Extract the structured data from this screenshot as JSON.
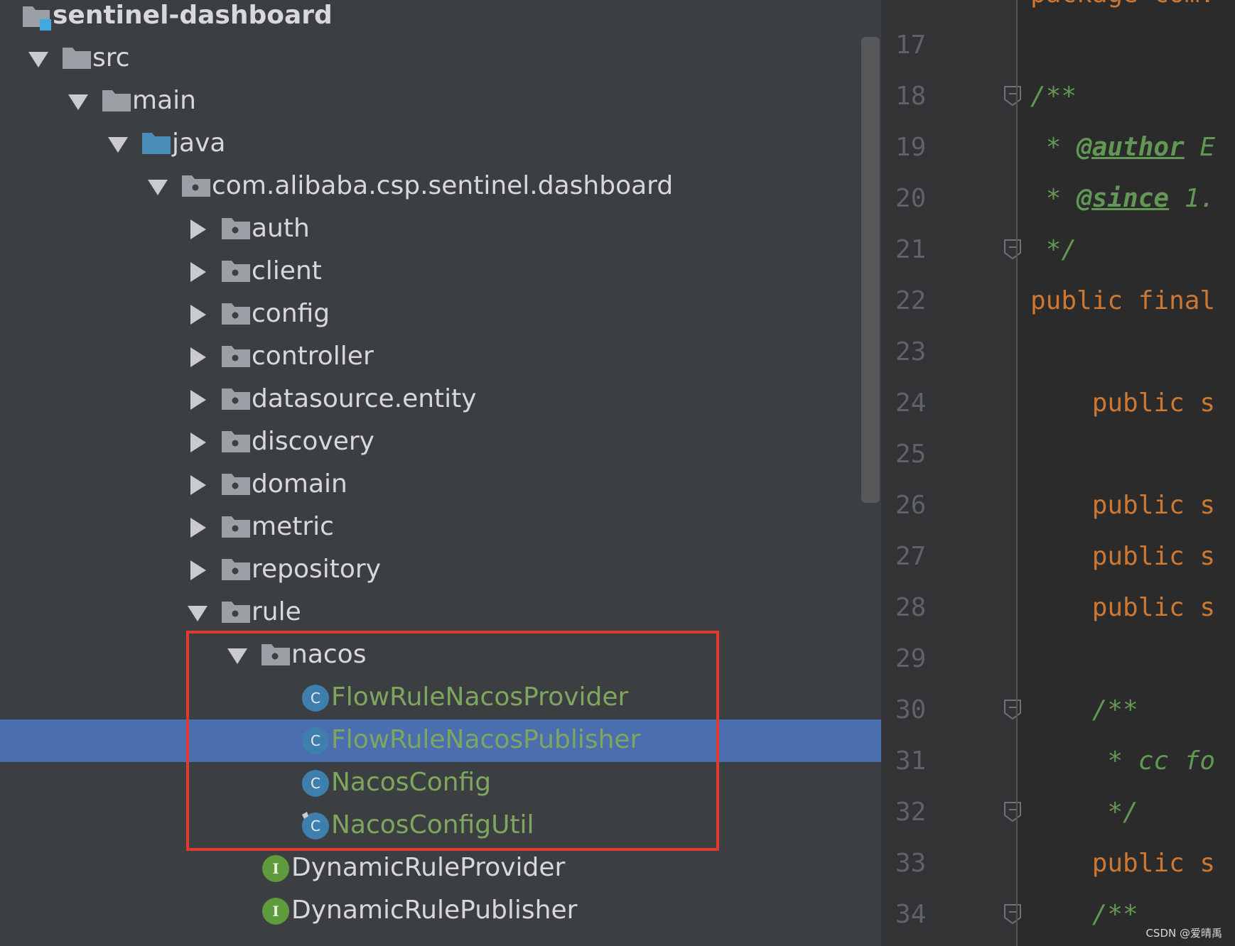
{
  "tree": {
    "items": [
      {
        "label": "sentinel-dashboard",
        "icon": "module-folder-icon",
        "arrow": "none",
        "indent": 0,
        "kind": "module"
      },
      {
        "label": "src",
        "icon": "folder-icon",
        "arrow": "down",
        "indent": 1,
        "kind": "folder"
      },
      {
        "label": "main",
        "icon": "folder-icon",
        "arrow": "down",
        "indent": 2,
        "kind": "folder"
      },
      {
        "label": "java",
        "icon": "source-folder-icon",
        "arrow": "down",
        "indent": 3,
        "kind": "source"
      },
      {
        "label": "com.alibaba.csp.sentinel.dashboard",
        "icon": "package-icon",
        "arrow": "down",
        "indent": 4,
        "kind": "package"
      },
      {
        "label": "auth",
        "icon": "package-icon",
        "arrow": "right",
        "indent": 5,
        "kind": "package"
      },
      {
        "label": "client",
        "icon": "package-icon",
        "arrow": "right",
        "indent": 5,
        "kind": "package"
      },
      {
        "label": "config",
        "icon": "package-icon",
        "arrow": "right",
        "indent": 5,
        "kind": "package"
      },
      {
        "label": "controller",
        "icon": "package-icon",
        "arrow": "right",
        "indent": 5,
        "kind": "package"
      },
      {
        "label": "datasource.entity",
        "icon": "package-icon",
        "arrow": "right",
        "indent": 5,
        "kind": "package"
      },
      {
        "label": "discovery",
        "icon": "package-icon",
        "arrow": "right",
        "indent": 5,
        "kind": "package"
      },
      {
        "label": "domain",
        "icon": "package-icon",
        "arrow": "right",
        "indent": 5,
        "kind": "package"
      },
      {
        "label": "metric",
        "icon": "package-icon",
        "arrow": "right",
        "indent": 5,
        "kind": "package"
      },
      {
        "label": "repository",
        "icon": "package-icon",
        "arrow": "right",
        "indent": 5,
        "kind": "package"
      },
      {
        "label": "rule",
        "icon": "package-icon",
        "arrow": "down",
        "indent": 5,
        "kind": "package"
      },
      {
        "label": "nacos",
        "icon": "package-icon",
        "arrow": "down",
        "indent": 6,
        "kind": "package"
      },
      {
        "label": "FlowRuleNacosProvider",
        "icon": "class-icon",
        "arrow": "none",
        "indent": 7,
        "kind": "class"
      },
      {
        "label": "FlowRuleNacosPublisher",
        "icon": "class-icon",
        "arrow": "none",
        "indent": 7,
        "kind": "class",
        "selected": true
      },
      {
        "label": "NacosConfig",
        "icon": "class-icon",
        "arrow": "none",
        "indent": 7,
        "kind": "class"
      },
      {
        "label": "NacosConfigUtil",
        "icon": "final-class-icon",
        "arrow": "none",
        "indent": 7,
        "kind": "class"
      },
      {
        "label": "DynamicRuleProvider",
        "icon": "interface-icon",
        "arrow": "none",
        "indent": 6,
        "kind": "interface"
      },
      {
        "label": "DynamicRulePublisher",
        "icon": "interface-icon",
        "arrow": "none",
        "indent": 6,
        "kind": "interface"
      }
    ]
  },
  "editor": {
    "first_partial": "package com.",
    "lines": [
      {
        "n": "17",
        "fold": false,
        "segments": []
      },
      {
        "n": "18",
        "fold": true,
        "segments": [
          {
            "t": "/**",
            "c": "cm",
            "indent": 0
          }
        ]
      },
      {
        "n": "19",
        "fold": false,
        "segments": [
          {
            "t": " * ",
            "c": "cm",
            "indent": 0
          },
          {
            "t": "@author",
            "c": "tag"
          },
          {
            "t": " E",
            "c": "cm"
          }
        ]
      },
      {
        "n": "20",
        "fold": false,
        "segments": [
          {
            "t": " * ",
            "c": "cm",
            "indent": 0
          },
          {
            "t": "@since",
            "c": "tag"
          },
          {
            "t": " 1.",
            "c": "cm"
          }
        ]
      },
      {
        "n": "21",
        "fold": true,
        "segments": [
          {
            "t": " */",
            "c": "cm",
            "indent": 0
          }
        ]
      },
      {
        "n": "22",
        "fold": false,
        "segments": [
          {
            "t": "public final",
            "c": "kw",
            "indent": 0
          }
        ]
      },
      {
        "n": "23",
        "fold": false,
        "segments": []
      },
      {
        "n": "24",
        "fold": false,
        "segments": [
          {
            "t": "    public s",
            "c": "kw",
            "indent": 0
          }
        ]
      },
      {
        "n": "25",
        "fold": false,
        "segments": []
      },
      {
        "n": "26",
        "fold": false,
        "segments": [
          {
            "t": "    public s",
            "c": "kw",
            "indent": 0
          }
        ]
      },
      {
        "n": "27",
        "fold": false,
        "segments": [
          {
            "t": "    public s",
            "c": "kw",
            "indent": 0
          }
        ]
      },
      {
        "n": "28",
        "fold": false,
        "segments": [
          {
            "t": "    public s",
            "c": "kw",
            "indent": 0
          }
        ]
      },
      {
        "n": "29",
        "fold": false,
        "segments": []
      },
      {
        "n": "30",
        "fold": true,
        "segments": [
          {
            "t": "    /**",
            "c": "cm",
            "indent": 0
          }
        ]
      },
      {
        "n": "31",
        "fold": false,
        "segments": [
          {
            "t": "     * cc fo",
            "c": "cm",
            "indent": 0
          }
        ]
      },
      {
        "n": "32",
        "fold": true,
        "segments": [
          {
            "t": "     */",
            "c": "cm",
            "indent": 0
          }
        ]
      },
      {
        "n": "33",
        "fold": false,
        "segments": [
          {
            "t": "    public s",
            "c": "kw",
            "indent": 0
          }
        ]
      },
      {
        "n": "34",
        "fold": true,
        "segments": [
          {
            "t": "    /**",
            "c": "cm",
            "indent": 0
          }
        ]
      }
    ]
  },
  "colors": {
    "tree_bg": "#3c3f41",
    "selection": "#4b6eaf",
    "class_text": "#7fa65f",
    "highlight_box": "#e03a30",
    "keyword": "#cc7832",
    "comment": "#629755"
  },
  "watermark": "CSDN @爱晴禹"
}
